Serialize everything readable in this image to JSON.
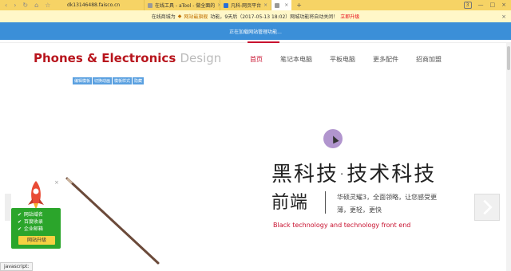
{
  "browser": {
    "url": "dk13146488.faisco.cn",
    "tabs": [
      {
        "title": "在线工具 - aTool - 做全面的"
      },
      {
        "title": "凡科-网页平台"
      },
      {
        "title": ""
      }
    ],
    "badge": "3"
  },
  "notice": {
    "prefix": "在线商城为",
    "gold": "网站最旗舰",
    "mid": "功能，9天后（2017-05-13 18:02）网城功能将自动关闭！",
    "link": "立即升级"
  },
  "loading_text": "正在加载网站管理功能...",
  "header": {
    "logo_main": "Phones & Electronics",
    "logo_suffix": "Design",
    "nav": [
      "首页",
      "笔记本电脑",
      "平板电脑",
      "更多配件",
      "招商加盟"
    ]
  },
  "chips": [
    "编辑模板",
    "切换动画",
    "模板样式",
    "隐藏"
  ],
  "hero": {
    "title": "黑科技·技术科技",
    "subtitle": "前端",
    "desc": "华硕灵耀3，全面领略，让您感受更薄，更轻，更快",
    "english": "Black technology and technology front end"
  },
  "widget": {
    "items": [
      "网站域名",
      "百度收录",
      "企业邮箱"
    ],
    "button": "网站升级"
  },
  "status": "javascript:"
}
